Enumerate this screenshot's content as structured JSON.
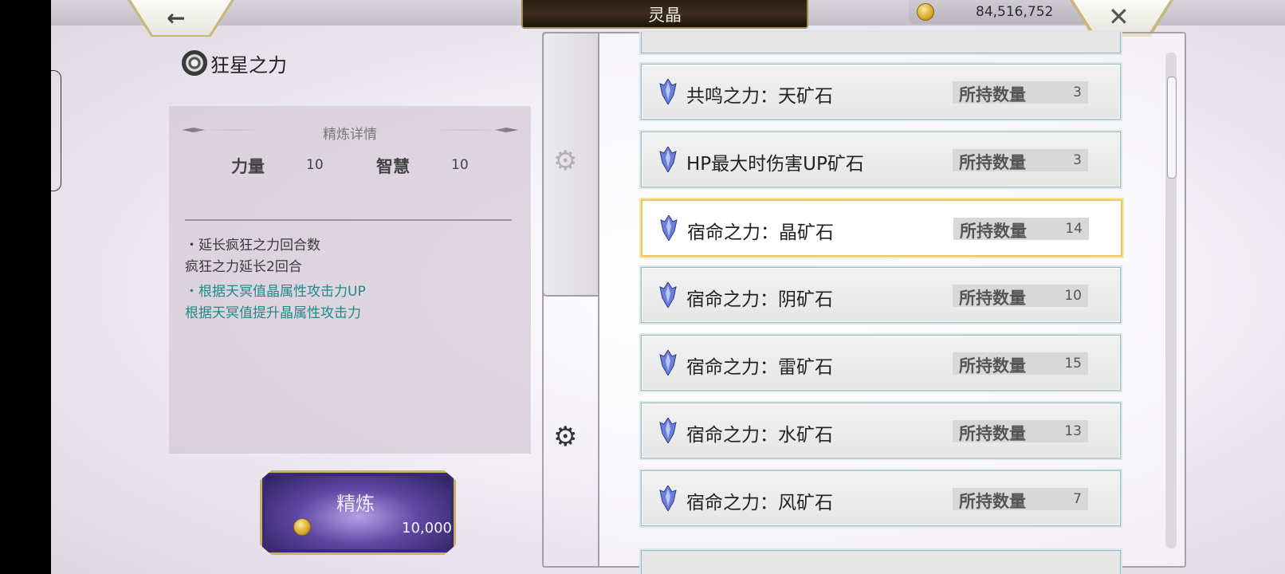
{
  "header": {
    "title": "灵晶",
    "gold": "84,516,752"
  },
  "skill": {
    "name": "狂星之力"
  },
  "detail": {
    "heading": "精炼详情",
    "stats": [
      {
        "label": "力量",
        "value": "10"
      },
      {
        "label": "智慧",
        "value": "10"
      }
    ],
    "effects": [
      {
        "title": "・延长疯狂之力回合数",
        "desc": "疯狂之力延长2回合",
        "color": "#3a3a3a"
      },
      {
        "title": "・根据天冥值晶属性攻击力UP",
        "desc": "根据天冥值提升晶属性攻击力",
        "color": "#1f8a86"
      }
    ]
  },
  "refine_button": {
    "label": "精炼",
    "cost": "10,000"
  },
  "items": [
    {
      "name": "共鸣之力：天矿石",
      "owned_label": "所持数量",
      "count": "3",
      "selected": false
    },
    {
      "name": "HP最大时伤害UP矿石",
      "owned_label": "所持数量",
      "count": "3",
      "selected": false
    },
    {
      "name": "宿命之力：晶矿石",
      "owned_label": "所持数量",
      "count": "14",
      "selected": true
    },
    {
      "name": "宿命之力：阴矿石",
      "owned_label": "所持数量",
      "count": "10",
      "selected": false
    },
    {
      "name": "宿命之力：雷矿石",
      "owned_label": "所持数量",
      "count": "15",
      "selected": false
    },
    {
      "name": "宿命之力：水矿石",
      "owned_label": "所持数量",
      "count": "13",
      "selected": false
    },
    {
      "name": "宿命之力：风矿石",
      "owned_label": "所持数量",
      "count": "7",
      "selected": false
    }
  ],
  "icons": {
    "back": "back-arrow-icon",
    "close": "close-icon",
    "gold": "gold-coin-icon",
    "tab_add": "gear-plus-icon",
    "tab_upgrade": "gear-up-icon",
    "item": "blue-crystal-icon"
  }
}
